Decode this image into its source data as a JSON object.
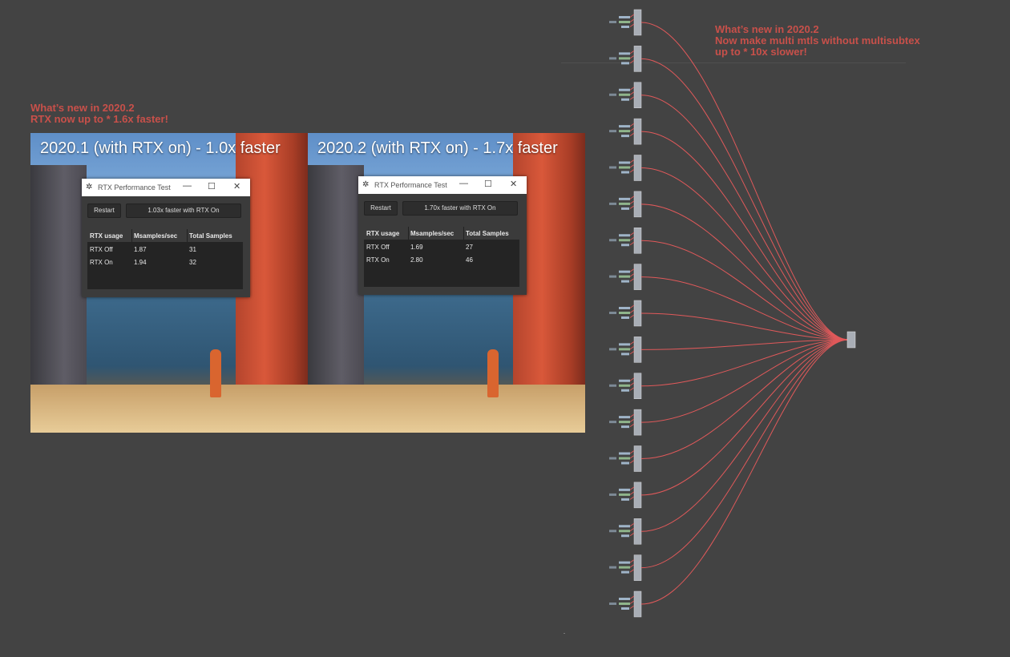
{
  "captions": {
    "left": [
      "What’s new in 2020.2",
      "RTX now up to * 1.6x faster!"
    ],
    "right": [
      "What’s new in 2020.2",
      "Now make multi mtls without multisubtex",
      "up to * 10x slower!"
    ]
  },
  "panels": [
    {
      "title": "2020.1 (with RTX on) - 1.0x faster",
      "window": {
        "title": "RTX Performance Test",
        "restart_label": "Restart",
        "status": "1.03x faster with RTX On",
        "columns": [
          "RTX usage",
          "Msamples/sec",
          "Total Samples"
        ],
        "rows": [
          [
            "RTX Off",
            "1.87",
            "31"
          ],
          [
            "RTX On",
            "1.94",
            "32"
          ]
        ]
      }
    },
    {
      "title": "2020.2 (with RTX on) - 1.7x faster",
      "window": {
        "title": "RTX Performance Test",
        "restart_label": "Restart",
        "status": "1.70x faster with RTX On",
        "columns": [
          "RTX usage",
          "Msamples/sec",
          "Total Samples"
        ],
        "rows": [
          [
            "RTX Off",
            "1.69",
            "27"
          ],
          [
            "RTX On",
            "2.80",
            "46"
          ]
        ]
      }
    }
  ],
  "node_graph": {
    "node_count": 17,
    "wire_color": "#e0595a",
    "target_node_color": "#a9aeb6"
  },
  "window_controls": {
    "minimize": "—",
    "maximize": "☐",
    "close": "✕"
  }
}
